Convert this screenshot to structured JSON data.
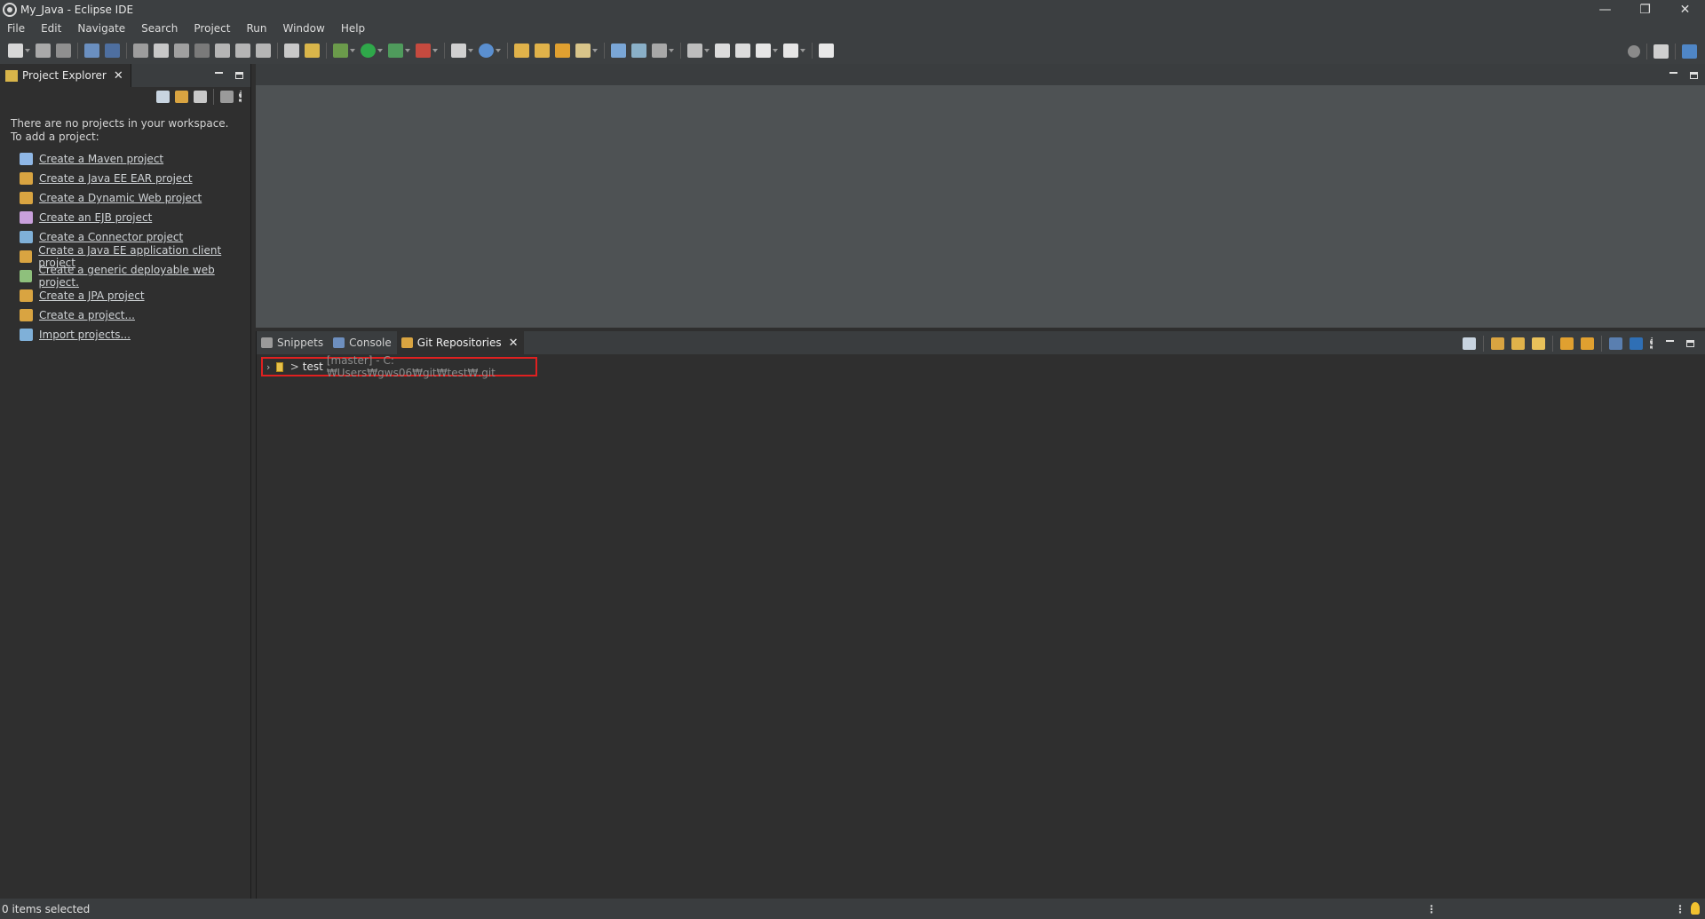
{
  "window": {
    "title": "My_Java - Eclipse IDE",
    "controls": [
      "—",
      "❐",
      "✕"
    ]
  },
  "menubar": {
    "items": [
      "File",
      "Edit",
      "Navigate",
      "Search",
      "Project",
      "Run",
      "Window",
      "Help"
    ]
  },
  "project_explorer": {
    "tab_label": "Project Explorer",
    "close_glyph": "✕",
    "message_line1": "There are no projects in your workspace.",
    "message_line2": "To add a project:",
    "links": [
      {
        "label": "Create a Maven project",
        "icon": "maven-project-icon",
        "color": "#8fb7e6"
      },
      {
        "label": "Create a Java EE EAR project",
        "icon": "ear-project-icon",
        "color": "#d9a441"
      },
      {
        "label": "Create a Dynamic Web project",
        "icon": "web-project-icon",
        "color": "#d9a441"
      },
      {
        "label": "Create an EJB project",
        "icon": "ejb-project-icon",
        "color": "#c9a0dc"
      },
      {
        "label": "Create a Connector project",
        "icon": "connector-project-icon",
        "color": "#7fb0d8"
      },
      {
        "label": "Create a Java EE application client project",
        "icon": "app-client-project-icon",
        "color": "#d9a441"
      },
      {
        "label": "Create a generic deployable web project.",
        "icon": "generic-web-project-icon",
        "color": "#8ec07c"
      },
      {
        "label": "Create a JPA project",
        "icon": "jpa-project-icon",
        "color": "#d9a441"
      },
      {
        "label": "Create a project...",
        "icon": "new-project-icon",
        "color": "#d9a441"
      },
      {
        "label": "Import projects...",
        "icon": "import-projects-icon",
        "color": "#7fb0d8"
      }
    ]
  },
  "bottom_panel": {
    "tabs": [
      {
        "label": "Snippets",
        "icon": "snippets-icon",
        "active": false
      },
      {
        "label": "Console",
        "icon": "console-icon",
        "active": false
      },
      {
        "label": "Git Repositories",
        "icon": "git-repositories-icon",
        "active": true
      }
    ],
    "close_glyph": "✕",
    "repository": {
      "chevron": "›",
      "dirty_marker": ">",
      "name": "test",
      "meta": "[master] - C:₩Users₩gws06₩git₩test₩.git"
    }
  },
  "statusbar": {
    "text": "0 items selected"
  },
  "colors": {
    "chrome": "#3c3f41",
    "panel": "#2f2f2f",
    "editor": "#4e5254",
    "highlight_border": "#e02020"
  }
}
